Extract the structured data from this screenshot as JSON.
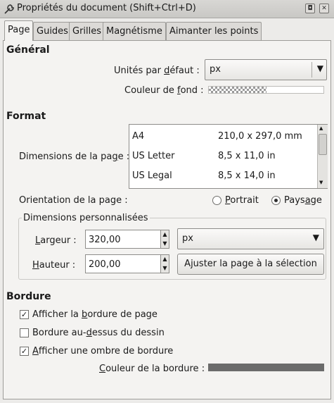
{
  "window": {
    "title": "Propriétés du document (Shift+Ctrl+D)",
    "title_icon": "wrench-icon",
    "buttons": [
      "restore-icon",
      "close-icon"
    ]
  },
  "tabs": [
    {
      "label": "Page",
      "active": true
    },
    {
      "label": "Guides",
      "active": false
    },
    {
      "label": "Grilles",
      "active": false
    },
    {
      "label": "Magnétisme",
      "active": false
    },
    {
      "label": "Aimanter les points",
      "active": false
    }
  ],
  "general": {
    "heading": "Général",
    "units_label_pre": "Unités par ",
    "units_label_u": "d",
    "units_label_post": "éfaut :",
    "units_value": "px",
    "bg_color_label_pre": "Couleur de ",
    "bg_color_label_u": "f",
    "bg_color_label_post": "ond :"
  },
  "format": {
    "heading": "Format",
    "page_size_label_pre": "Dimensions de la pa",
    "page_size_label_u": "g",
    "page_size_label_post": "e :",
    "sizes": [
      {
        "name": "A4",
        "dims": "210,0 x 297,0 mm"
      },
      {
        "name": "US Letter",
        "dims": "8,5 x 11,0 in"
      },
      {
        "name": "US Legal",
        "dims": "8,5 x 14,0 in"
      }
    ],
    "orientation_label": "Orientation de la page :",
    "portrait_u": "P",
    "portrait_rest": "ortrait",
    "landscape_pre": "Pays",
    "landscape_u": "a",
    "landscape_post": "ge",
    "orientation_selected": "Paysage"
  },
  "custom": {
    "legend": "Dimensions personnalisées",
    "width_label_u": "L",
    "width_label_rest": "argeur :",
    "width_value": "320,00",
    "height_label_u": "H",
    "height_label_rest": "auteur :",
    "height_value": "200,00",
    "units_value": "px",
    "fit_button": "Ajuster la page à la sélection"
  },
  "border": {
    "heading": "Bordure",
    "show_border_pre": "Afficher la ",
    "show_border_u": "b",
    "show_border_post": "ordure de page",
    "show_border_checked": true,
    "border_on_top_pre": "Bordure au-",
    "border_on_top_u": "d",
    "border_on_top_post": "essus du dessin",
    "border_on_top_checked": false,
    "shadow_u": "A",
    "shadow_rest": "fficher une ombre de bordure",
    "shadow_checked": true,
    "border_color_u": "C",
    "border_color_rest": "ouleur de la bordure :",
    "border_color": "#6b6b6b"
  },
  "glyphs": {
    "check": "✓",
    "arrow_down": "▼",
    "arrow_up": "▲",
    "restore": "◘",
    "close": "✕"
  }
}
